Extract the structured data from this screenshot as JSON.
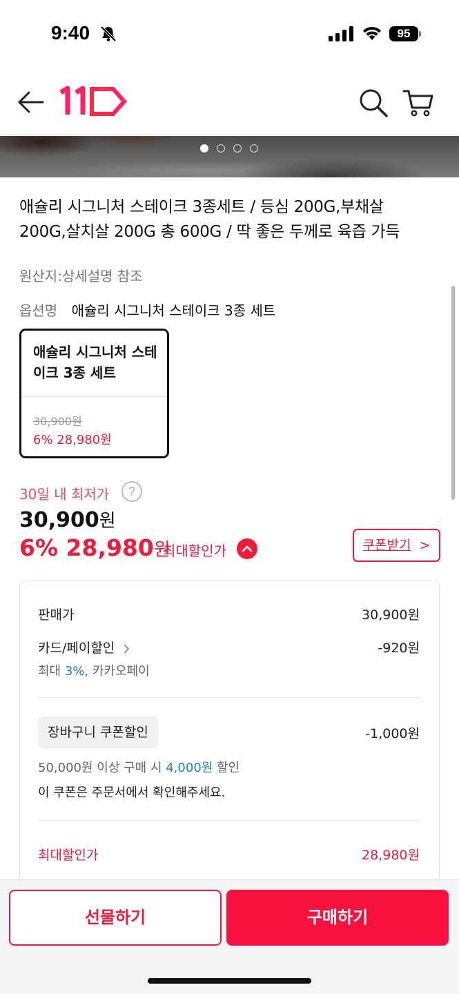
{
  "status_bar": {
    "time": "9:40",
    "battery": "95",
    "icons": [
      "bell-off-icon",
      "signal-icon",
      "wifi-icon",
      "battery-icon"
    ]
  },
  "header": {
    "icons": [
      "back-arrow-icon",
      "11st-logo",
      "search-icon",
      "cart-icon"
    ],
    "brand_color": "#f01b3c"
  },
  "gallery": {
    "slide_count": 4,
    "active_slide": 1
  },
  "product": {
    "title": "애슐리 시그니처 스테이크 3종세트 / 등심 200G,부채살 200G,살치살 200G 총 600G / 딱 좋은 두께로 육즙 가득",
    "origin": "원산지:상세설명 참조",
    "option_key": "옵션명",
    "option_value": "애슐리 시그니처 스테이크 3종 세트"
  },
  "option_card": {
    "name": "애슐리 시그니처 스테이크 3종 세트",
    "original_price": "30,900원",
    "sale_price": "6% 28,980원"
  },
  "pricing": {
    "lowest_label": "30일 내 최저가",
    "help_symbol": "?",
    "original_amount": "30,900",
    "original_unit": "원",
    "sale_amount": "6% 28,980",
    "sale_unit": "원",
    "max_discount_label": "최대할인가",
    "coupon_button": "쿠폰받기",
    "coupon_chevron": ">"
  },
  "breakdown": {
    "sell_price_label": "판매가",
    "sell_price_value": "30,900원",
    "card_label": "카드/페이할인",
    "card_value": "-920원",
    "card_sub_prefix": "최대 ",
    "card_sub_highlight": "3%",
    "card_sub_suffix": ", 카카오페이",
    "cart_coupon_label": "장바구니 쿠폰할인",
    "cart_coupon_value": "-1,000원",
    "cart_coupon_cond_prefix": "50,000원 이상 구매 시 ",
    "cart_coupon_cond_highlight": "4,000원",
    "cart_coupon_cond_suffix": " 할인",
    "cart_coupon_note": "이 쿠폰은 주문서에서 확인해주세요.",
    "max_price_label": "최대할인가",
    "max_price_value": "28,980원"
  },
  "bottom_bar": {
    "gift_button": "선물하기",
    "buy_button": "구매하기",
    "accent": "#f8103e"
  }
}
